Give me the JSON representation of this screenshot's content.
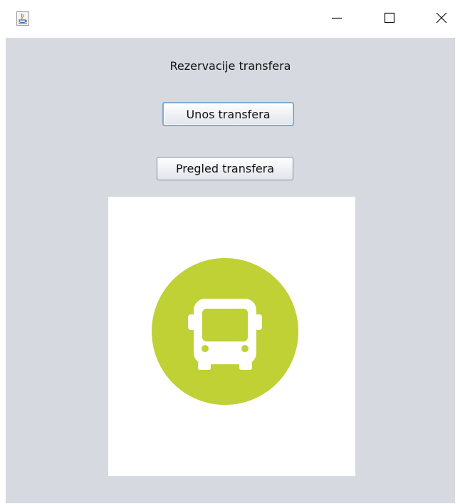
{
  "window": {
    "controls": {
      "minimize": "minimize-icon",
      "maximize": "maximize-icon",
      "close": "close-icon"
    }
  },
  "main": {
    "heading": "Rezervacije transfera",
    "buttons": {
      "unos_label": "Unos transfera",
      "pregled_label": "Pregled transfera"
    }
  },
  "image": {
    "icon": "bus-icon",
    "circle_color": "#bfd134",
    "glyph_color": "#ffffff"
  },
  "colors": {
    "panel_background": "#d6d9e0",
    "focus_border": "#7eaad3"
  }
}
